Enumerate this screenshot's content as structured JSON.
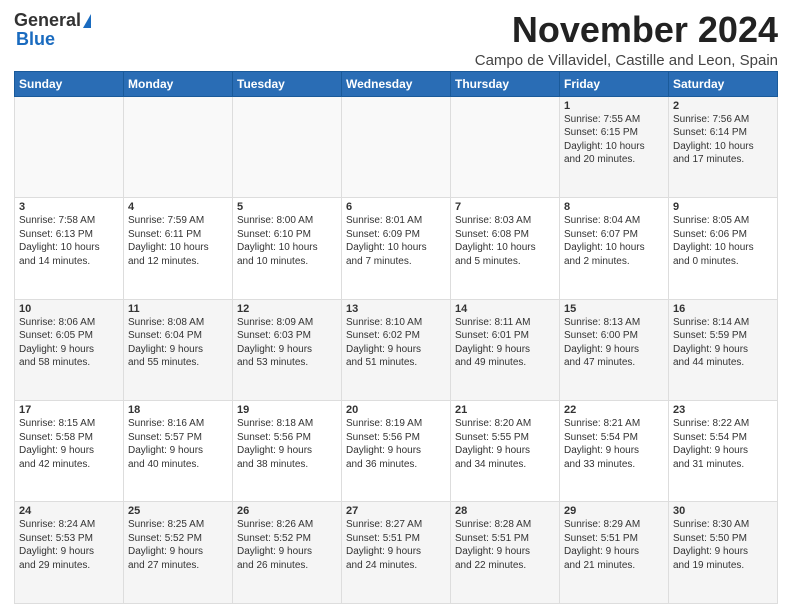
{
  "logo": {
    "line1": "General",
    "line2": "Blue"
  },
  "header": {
    "month": "November 2024",
    "location": "Campo de Villavidel, Castille and Leon, Spain"
  },
  "weekdays": [
    "Sunday",
    "Monday",
    "Tuesday",
    "Wednesday",
    "Thursday",
    "Friday",
    "Saturday"
  ],
  "weeks": [
    [
      {
        "day": "",
        "info": ""
      },
      {
        "day": "",
        "info": ""
      },
      {
        "day": "",
        "info": ""
      },
      {
        "day": "",
        "info": ""
      },
      {
        "day": "",
        "info": ""
      },
      {
        "day": "1",
        "info": "Sunrise: 7:55 AM\nSunset: 6:15 PM\nDaylight: 10 hours\nand 20 minutes."
      },
      {
        "day": "2",
        "info": "Sunrise: 7:56 AM\nSunset: 6:14 PM\nDaylight: 10 hours\nand 17 minutes."
      }
    ],
    [
      {
        "day": "3",
        "info": "Sunrise: 7:58 AM\nSunset: 6:13 PM\nDaylight: 10 hours\nand 14 minutes."
      },
      {
        "day": "4",
        "info": "Sunrise: 7:59 AM\nSunset: 6:11 PM\nDaylight: 10 hours\nand 12 minutes."
      },
      {
        "day": "5",
        "info": "Sunrise: 8:00 AM\nSunset: 6:10 PM\nDaylight: 10 hours\nand 10 minutes."
      },
      {
        "day": "6",
        "info": "Sunrise: 8:01 AM\nSunset: 6:09 PM\nDaylight: 10 hours\nand 7 minutes."
      },
      {
        "day": "7",
        "info": "Sunrise: 8:03 AM\nSunset: 6:08 PM\nDaylight: 10 hours\nand 5 minutes."
      },
      {
        "day": "8",
        "info": "Sunrise: 8:04 AM\nSunset: 6:07 PM\nDaylight: 10 hours\nand 2 minutes."
      },
      {
        "day": "9",
        "info": "Sunrise: 8:05 AM\nSunset: 6:06 PM\nDaylight: 10 hours\nand 0 minutes."
      }
    ],
    [
      {
        "day": "10",
        "info": "Sunrise: 8:06 AM\nSunset: 6:05 PM\nDaylight: 9 hours\nand 58 minutes."
      },
      {
        "day": "11",
        "info": "Sunrise: 8:08 AM\nSunset: 6:04 PM\nDaylight: 9 hours\nand 55 minutes."
      },
      {
        "day": "12",
        "info": "Sunrise: 8:09 AM\nSunset: 6:03 PM\nDaylight: 9 hours\nand 53 minutes."
      },
      {
        "day": "13",
        "info": "Sunrise: 8:10 AM\nSunset: 6:02 PM\nDaylight: 9 hours\nand 51 minutes."
      },
      {
        "day": "14",
        "info": "Sunrise: 8:11 AM\nSunset: 6:01 PM\nDaylight: 9 hours\nand 49 minutes."
      },
      {
        "day": "15",
        "info": "Sunrise: 8:13 AM\nSunset: 6:00 PM\nDaylight: 9 hours\nand 47 minutes."
      },
      {
        "day": "16",
        "info": "Sunrise: 8:14 AM\nSunset: 5:59 PM\nDaylight: 9 hours\nand 44 minutes."
      }
    ],
    [
      {
        "day": "17",
        "info": "Sunrise: 8:15 AM\nSunset: 5:58 PM\nDaylight: 9 hours\nand 42 minutes."
      },
      {
        "day": "18",
        "info": "Sunrise: 8:16 AM\nSunset: 5:57 PM\nDaylight: 9 hours\nand 40 minutes."
      },
      {
        "day": "19",
        "info": "Sunrise: 8:18 AM\nSunset: 5:56 PM\nDaylight: 9 hours\nand 38 minutes."
      },
      {
        "day": "20",
        "info": "Sunrise: 8:19 AM\nSunset: 5:56 PM\nDaylight: 9 hours\nand 36 minutes."
      },
      {
        "day": "21",
        "info": "Sunrise: 8:20 AM\nSunset: 5:55 PM\nDaylight: 9 hours\nand 34 minutes."
      },
      {
        "day": "22",
        "info": "Sunrise: 8:21 AM\nSunset: 5:54 PM\nDaylight: 9 hours\nand 33 minutes."
      },
      {
        "day": "23",
        "info": "Sunrise: 8:22 AM\nSunset: 5:54 PM\nDaylight: 9 hours\nand 31 minutes."
      }
    ],
    [
      {
        "day": "24",
        "info": "Sunrise: 8:24 AM\nSunset: 5:53 PM\nDaylight: 9 hours\nand 29 minutes."
      },
      {
        "day": "25",
        "info": "Sunrise: 8:25 AM\nSunset: 5:52 PM\nDaylight: 9 hours\nand 27 minutes."
      },
      {
        "day": "26",
        "info": "Sunrise: 8:26 AM\nSunset: 5:52 PM\nDaylight: 9 hours\nand 26 minutes."
      },
      {
        "day": "27",
        "info": "Sunrise: 8:27 AM\nSunset: 5:51 PM\nDaylight: 9 hours\nand 24 minutes."
      },
      {
        "day": "28",
        "info": "Sunrise: 8:28 AM\nSunset: 5:51 PM\nDaylight: 9 hours\nand 22 minutes."
      },
      {
        "day": "29",
        "info": "Sunrise: 8:29 AM\nSunset: 5:51 PM\nDaylight: 9 hours\nand 21 minutes."
      },
      {
        "day": "30",
        "info": "Sunrise: 8:30 AM\nSunset: 5:50 PM\nDaylight: 9 hours\nand 19 minutes."
      }
    ]
  ]
}
